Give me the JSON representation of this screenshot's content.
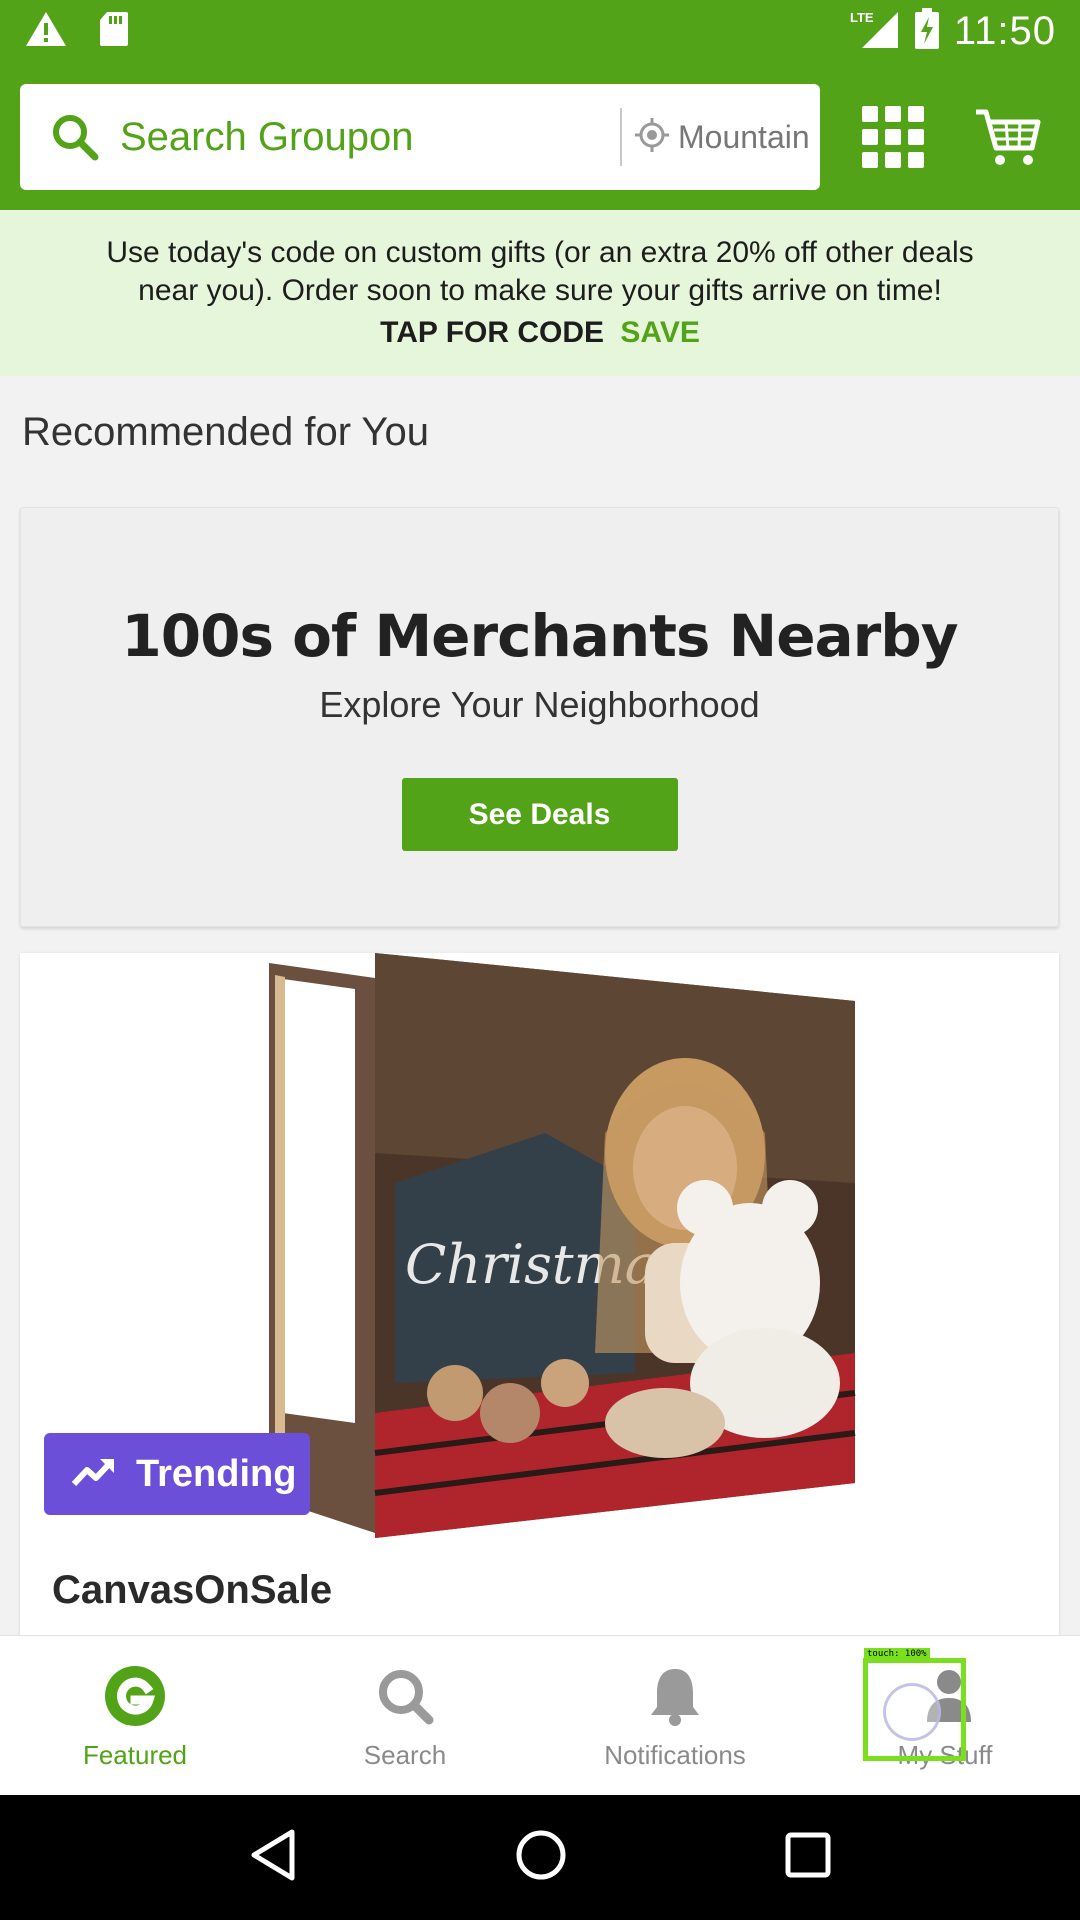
{
  "status_bar": {
    "time": "11:50",
    "network": "LTE"
  },
  "header": {
    "search_placeholder": "Search Groupon",
    "location": "Mountain"
  },
  "promo": {
    "line1": "Use today's code on custom gifts (or an extra 20% off other deals",
    "line2": "near you). Order soon to make sure your gifts arrive on time!",
    "cta_label": "TAP FOR CODE",
    "code": "SAVE"
  },
  "section": {
    "title": "Recommended for You"
  },
  "merchants_card": {
    "title": "100s of Merchants Nearby",
    "subtitle": "Explore Your Neighborhood",
    "button_label": "See Deals"
  },
  "deal_card": {
    "badge_label": "Trending",
    "merchant": "CanvasOnSale"
  },
  "bottom_nav": {
    "items": [
      {
        "label": "Featured",
        "icon": "groupon-g-icon",
        "active": true
      },
      {
        "label": "Search",
        "icon": "search-icon",
        "active": false
      },
      {
        "label": "Notifications",
        "icon": "bell-icon",
        "active": false
      },
      {
        "label": "My Stuff",
        "icon": "person-icon",
        "active": false
      }
    ]
  },
  "touch_indicator": {
    "label": "touch: 100%"
  },
  "colors": {
    "brand_green": "#53a318",
    "promo_bg": "#e6f6da",
    "trending_purple": "#6b4fd8"
  }
}
